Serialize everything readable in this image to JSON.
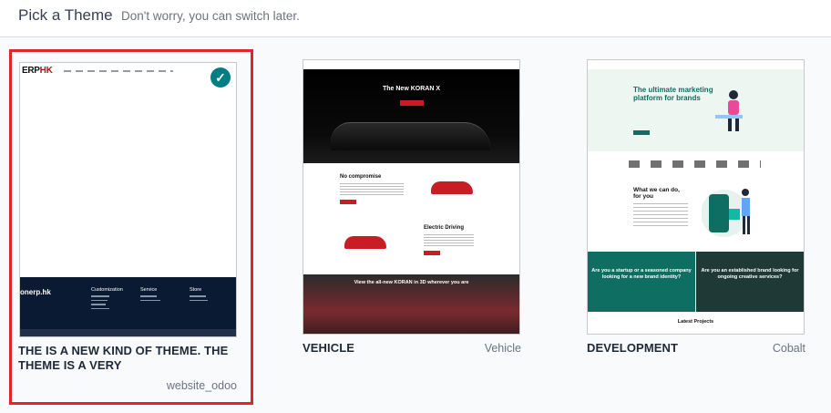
{
  "header": {
    "title": "Pick a Theme",
    "subtitle": "Don't worry, you can switch later."
  },
  "colors": {
    "selected_border": "#e0242b",
    "check_badge": "#017e84"
  },
  "themes": [
    {
      "name": "THE IS A NEW KIND OF THEME. THE THEME IS A VERY",
      "tag": "website_odoo",
      "selected": true,
      "preview": {
        "logo_main": "ERP",
        "logo_accent": "HK",
        "footer_brand": "onerp.hk",
        "footer_columns": [
          "Customization",
          "Service",
          "Store"
        ]
      }
    },
    {
      "name": "VEHICLE",
      "tag": "Vehicle",
      "selected": false,
      "preview": {
        "hero_title": "The New KORAN X",
        "section1_title": "No compromise",
        "section2_title": "Electric Driving",
        "banner_title": "View the all-new KORAN in 3D wherever you are"
      }
    },
    {
      "name": "DEVELOPMENT",
      "tag": "Cobalt",
      "selected": false,
      "preview": {
        "hero_title": "The ultimate marketing platform for brands",
        "section_title": "What we can do, for you",
        "panel_left": "Are you a startup or a seasoned company looking for a new brand identity?",
        "panel_right": "Are you an established brand looking for ongoing creative services?",
        "footer_title": "Latest Projects"
      }
    }
  ]
}
